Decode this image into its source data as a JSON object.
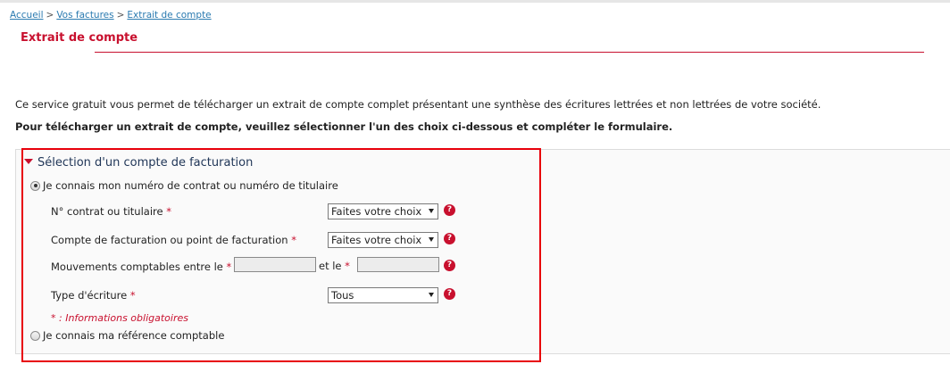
{
  "breadcrumb": {
    "items": [
      "Accueil",
      "Vos factures",
      "Extrait de compte"
    ],
    "separator": ">"
  },
  "page": {
    "title": "Extrait de compte",
    "intro": "Ce service gratuit vous permet de télécharger un extrait de compte complet présentant une synthèse des écritures lettrées et non lettrées de votre société.",
    "instruction": "Pour télécharger un extrait de compte, veuillez sélectionner l'un des choix ci-dessous et compléter le formulaire."
  },
  "section": {
    "title": "Sélection d'un compte de facturation",
    "option1_label": "Je connais mon numéro de contrat ou numéro de titulaire",
    "option2_label": "Je connais ma référence comptable"
  },
  "form": {
    "contract_label": "N° contrat ou titulaire",
    "contract_value": "Faites votre choix",
    "billing_label": "Compte de facturation ou point de facturation",
    "billing_value": "Faites votre choix",
    "movements_label": "Mouvements comptables entre le",
    "and_label": "et le",
    "type_label": "Type d'écriture",
    "type_value": "Tous",
    "required_marker": "*",
    "help_glyph": "?",
    "mandatory_note": "* : Informations obligatoires"
  },
  "colors": {
    "accent": "#c8102e",
    "link": "#2a7ab0",
    "highlight": "#e8000b",
    "section_title": "#1f3557"
  }
}
